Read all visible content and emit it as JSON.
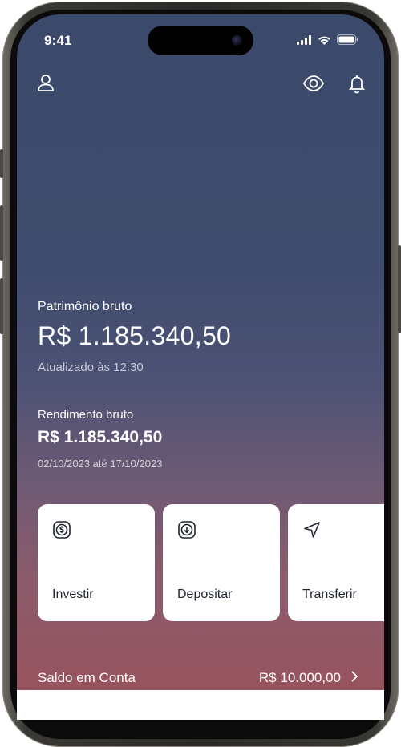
{
  "status_bar": {
    "time": "9:41"
  },
  "header": {
    "left_icon": "user-icon",
    "right_icons": [
      "eye-icon",
      "bell-icon"
    ]
  },
  "patrimonio": {
    "label": "Patrimônio bruto",
    "value": "R$ 1.185.340,50",
    "updated": "Atualizado às 12:30"
  },
  "rendimento": {
    "label": "Rendimento bruto",
    "value": "R$ 1.185.340,50",
    "period": "02/10/2023 até 17/10/2023"
  },
  "actions": [
    {
      "label": "Investir",
      "icon": "dollar-circle-icon"
    },
    {
      "label": "Depositar",
      "icon": "arrow-down-circle-icon"
    },
    {
      "label": "Transferir",
      "icon": "send-icon"
    }
  ],
  "saldo": {
    "label": "Saldo em Conta",
    "value": "R$ 10.000,00",
    "icon": "chevron-right-icon"
  },
  "colors": {
    "gradient_top": "#3b4a6b",
    "gradient_bottom": "#96525c",
    "card_bg": "#ffffff",
    "text_primary": "#ffffff"
  }
}
